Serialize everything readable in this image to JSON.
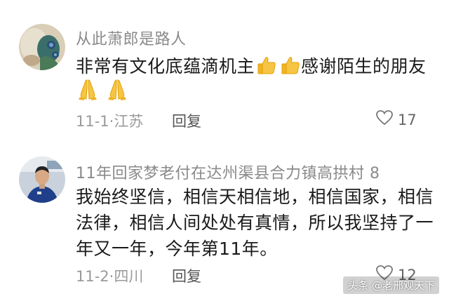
{
  "comments": [
    {
      "username": "从此萧郎是路人",
      "text_line1": "非常有文化底蕴滴机主",
      "text_line1_suffix": "感谢陌生的朋友",
      "emoji_line1": [
        "thumbs-up-icon",
        "thumbs-up-icon"
      ],
      "emoji_line2": [
        "praying-hands-icon",
        "praying-hands-icon"
      ],
      "date": "11-1",
      "location": "江苏",
      "reply_label": "回复",
      "likes": "17"
    },
    {
      "username": "11年回家梦老付在达州渠县合力镇高拱村 8",
      "text_line1": "我始终坚信，相信天相信地，相信国家，相信",
      "text_line2": "法律，相信人间处处有真情，所以我坚持了一",
      "text_line3": "年又一年，今年第11年。",
      "date": "11-2",
      "location": "四川",
      "reply_label": "回复",
      "likes": "12"
    }
  ],
  "separator": "·",
  "watermark": "头条 @老邢观天下"
}
